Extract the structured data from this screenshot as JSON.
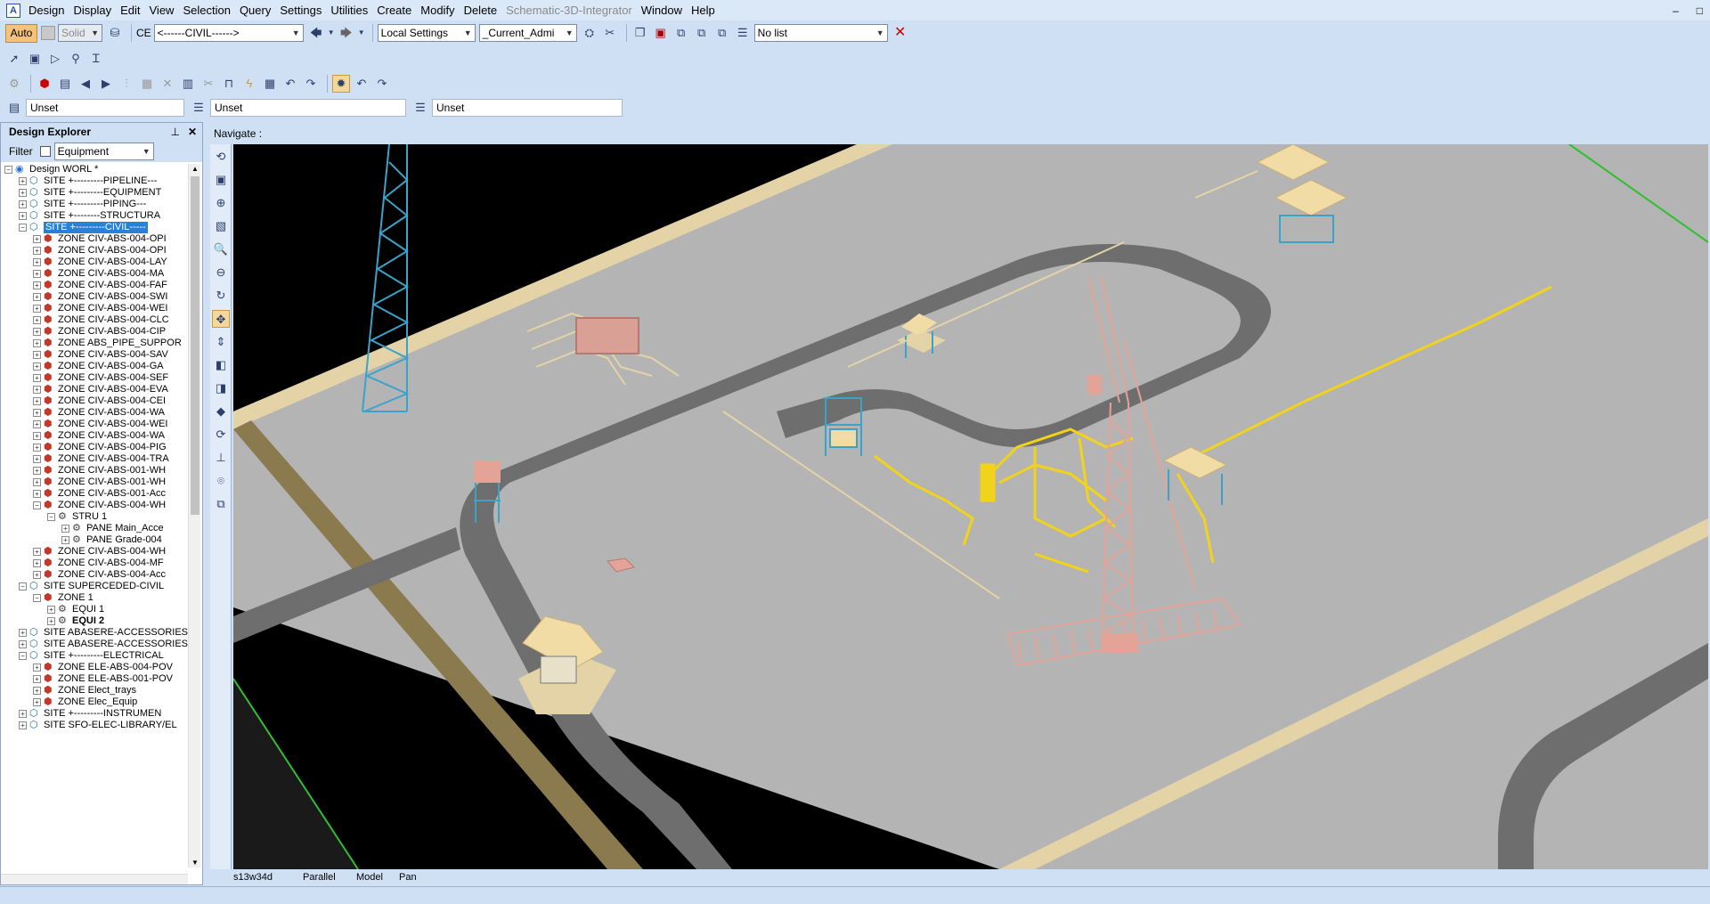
{
  "menu": [
    "Design",
    "Display",
    "Edit",
    "View",
    "Selection",
    "Query",
    "Settings",
    "Utilities",
    "Create",
    "Modify",
    "Delete"
  ],
  "menu_disabled": [
    "Schematic-3D-Integrator"
  ],
  "menu_tail": [
    "Window",
    "Help"
  ],
  "window_controls": [
    "–",
    "□"
  ],
  "toolbar": {
    "auto_label": "Auto",
    "solid_label": "Solid",
    "ce_label": "CE",
    "ce_value": "<------CIVIL------>",
    "local_settings": "Local Settings",
    "current_admin": "_Current_Admi",
    "list_value": "No list"
  },
  "unset_fields": [
    "Unset",
    "Unset",
    "Unset"
  ],
  "explorer": {
    "title": "Design Explorer",
    "pin": "📌",
    "close": "✕",
    "filter_label": "Filter",
    "filter_value": "Equipment"
  },
  "tree": [
    {
      "level": 0,
      "exp": "−",
      "kind": "world",
      "text": "Design WORL *"
    },
    {
      "level": 1,
      "exp": "+",
      "kind": "site",
      "text": "SITE +---------PIPELINE---"
    },
    {
      "level": 1,
      "exp": "+",
      "kind": "site",
      "text": "SITE +---------EQUIPMENT"
    },
    {
      "level": 1,
      "exp": "+",
      "kind": "site",
      "text": "SITE +---------PIPING---"
    },
    {
      "level": 1,
      "exp": "+",
      "kind": "site",
      "text": "SITE +--------STRUCTURA"
    },
    {
      "level": 1,
      "exp": "−",
      "kind": "site",
      "text": "SITE +---------CIVIL-----",
      "selected": true
    },
    {
      "level": 2,
      "exp": "+",
      "kind": "zone",
      "text": "ZONE CIV-ABS-004-OPI"
    },
    {
      "level": 2,
      "exp": "+",
      "kind": "zone",
      "text": "ZONE CIV-ABS-004-OPI"
    },
    {
      "level": 2,
      "exp": "+",
      "kind": "zone",
      "text": "ZONE CIV-ABS-004-LAY"
    },
    {
      "level": 2,
      "exp": "+",
      "kind": "zone",
      "text": "ZONE CIV-ABS-004-MA"
    },
    {
      "level": 2,
      "exp": "+",
      "kind": "zone",
      "text": "ZONE CIV-ABS-004-FAF"
    },
    {
      "level": 2,
      "exp": "+",
      "kind": "zone",
      "text": "ZONE CIV-ABS-004-SWI"
    },
    {
      "level": 2,
      "exp": "+",
      "kind": "zone",
      "text": "ZONE CIV-ABS-004-WEI"
    },
    {
      "level": 2,
      "exp": "+",
      "kind": "zone",
      "text": "ZONE CIV-ABS-004-CLC"
    },
    {
      "level": 2,
      "exp": "+",
      "kind": "zone",
      "text": "ZONE CIV-ABS-004-CIP"
    },
    {
      "level": 2,
      "exp": "+",
      "kind": "zone",
      "text": "ZONE ABS_PIPE_SUPPOR"
    },
    {
      "level": 2,
      "exp": "+",
      "kind": "zone",
      "text": "ZONE CIV-ABS-004-SAV"
    },
    {
      "level": 2,
      "exp": "+",
      "kind": "zone",
      "text": "ZONE CIV-ABS-004-GA"
    },
    {
      "level": 2,
      "exp": "+",
      "kind": "zone",
      "text": "ZONE CIV-ABS-004-SEF"
    },
    {
      "level": 2,
      "exp": "+",
      "kind": "zone",
      "text": "ZONE CIV-ABS-004-EVA"
    },
    {
      "level": 2,
      "exp": "+",
      "kind": "zone",
      "text": "ZONE CIV-ABS-004-CEI"
    },
    {
      "level": 2,
      "exp": "+",
      "kind": "zone",
      "text": "ZONE CIV-ABS-004-WA"
    },
    {
      "level": 2,
      "exp": "+",
      "kind": "zone",
      "text": "ZONE CIV-ABS-004-WEI"
    },
    {
      "level": 2,
      "exp": "+",
      "kind": "zone",
      "text": "ZONE CIV-ABS-004-WA"
    },
    {
      "level": 2,
      "exp": "+",
      "kind": "zone",
      "text": "ZONE CIV-ABS-004-PIG"
    },
    {
      "level": 2,
      "exp": "+",
      "kind": "zone",
      "text": "ZONE CIV-ABS-004-TRA"
    },
    {
      "level": 2,
      "exp": "+",
      "kind": "zone",
      "text": "ZONE CIV-ABS-001-WH"
    },
    {
      "level": 2,
      "exp": "+",
      "kind": "zone",
      "text": "ZONE CIV-ABS-001-WH"
    },
    {
      "level": 2,
      "exp": "+",
      "kind": "zone",
      "text": "ZONE CIV-ABS-001-Acc"
    },
    {
      "level": 2,
      "exp": "−",
      "kind": "zone",
      "text": "ZONE CIV-ABS-004-WH"
    },
    {
      "level": 3,
      "exp": "−",
      "kind": "other",
      "text": "STRU 1"
    },
    {
      "level": 4,
      "exp": "+",
      "kind": "other",
      "text": "PANE Main_Acce"
    },
    {
      "level": 4,
      "exp": "+",
      "kind": "other",
      "text": "PANE Grade-004"
    },
    {
      "level": 2,
      "exp": "+",
      "kind": "zone",
      "text": "ZONE CIV-ABS-004-WH"
    },
    {
      "level": 2,
      "exp": "+",
      "kind": "zone",
      "text": "ZONE CIV-ABS-004-MF"
    },
    {
      "level": 2,
      "exp": "+",
      "kind": "zone",
      "text": "ZONE CIV-ABS-004-Acc"
    },
    {
      "level": 1,
      "exp": "−",
      "kind": "site",
      "text": "SITE SUPERCEDED-CIVIL"
    },
    {
      "level": 2,
      "exp": "−",
      "kind": "zone",
      "text": "ZONE 1"
    },
    {
      "level": 3,
      "exp": "+",
      "kind": "other",
      "text": "EQUI 1"
    },
    {
      "level": 3,
      "exp": "+",
      "kind": "other",
      "text": "EQUI 2",
      "bold": true
    },
    {
      "level": 1,
      "exp": "+",
      "kind": "site",
      "text": "SITE ABASERE-ACCESSORIES"
    },
    {
      "level": 1,
      "exp": "+",
      "kind": "site",
      "text": "SITE ABASERE-ACCESSORIES"
    },
    {
      "level": 1,
      "exp": "−",
      "kind": "site",
      "text": "SITE +---------ELECTRICAL"
    },
    {
      "level": 2,
      "exp": "+",
      "kind": "zone",
      "text": "ZONE ELE-ABS-004-POV"
    },
    {
      "level": 2,
      "exp": "+",
      "kind": "zone",
      "text": "ZONE ELE-ABS-001-POV"
    },
    {
      "level": 2,
      "exp": "+",
      "kind": "zone",
      "text": "ZONE Elect_trays"
    },
    {
      "level": 2,
      "exp": "+",
      "kind": "zone",
      "text": "ZONE Elec_Equip"
    },
    {
      "level": 1,
      "exp": "+",
      "kind": "site",
      "text": "SITE +---------INSTRUMEN"
    },
    {
      "level": 1,
      "exp": "+",
      "kind": "site",
      "text": "SITE SFO-ELEC-LIBRARY/EL"
    }
  ],
  "viewport": {
    "title": "Navigate :",
    "status": [
      "s13w34d",
      "Parallel",
      "Model",
      "Pan"
    ]
  },
  "colors": {
    "ground": "#b4b4b4",
    "road": "#6e6e6e",
    "sand": "#e3d3a6",
    "steel_blue": "#3aa3c9",
    "pipe_yellow": "#f2d31b",
    "tower_pink": "#e3a396"
  }
}
